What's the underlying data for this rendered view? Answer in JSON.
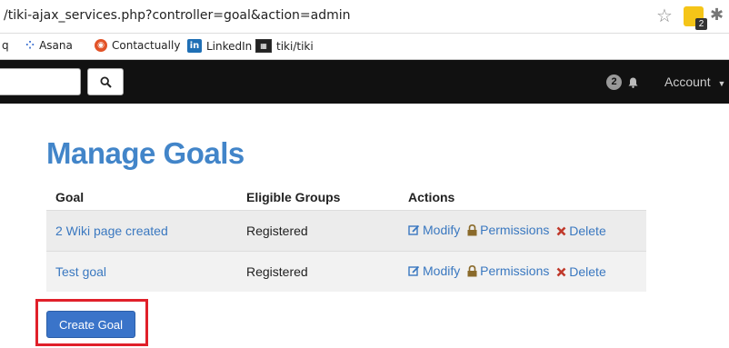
{
  "browser": {
    "url": "/tiki-ajax_services.php?controller=goal&action=admin",
    "ext_badge": "2"
  },
  "bookmarks": [
    {
      "label": "q"
    },
    {
      "label": "Asana",
      "icon": "asana-icon"
    },
    {
      "label": "Contactually",
      "icon": "contactually-icon"
    },
    {
      "label": "LinkedIn",
      "icon": "linkedin-icon",
      "icon_text": "in"
    },
    {
      "label": "tiki/tiki",
      "icon": "tiki-icon"
    }
  ],
  "navbar": {
    "search_value": "",
    "notification_count": "2",
    "account_label": "Account"
  },
  "page": {
    "title": "Manage Goals"
  },
  "table": {
    "headers": [
      "Goal",
      "Eligible Groups",
      "Actions"
    ],
    "rows": [
      {
        "goal": "2 Wiki page created",
        "groups": "Registered"
      },
      {
        "goal": "Test goal",
        "groups": "Registered"
      }
    ],
    "actions": {
      "modify": "Modify",
      "permissions": "Permissions",
      "delete": "Delete"
    }
  },
  "create_button_label": "Create Goal",
  "colors": {
    "title": "#4285c9",
    "link": "#3a78c0",
    "button": "#3a74c9",
    "highlight": "#e0202a",
    "navbar": "#111111",
    "permissions_icon": "#8a6a2a",
    "delete_icon": "#c0392b"
  }
}
